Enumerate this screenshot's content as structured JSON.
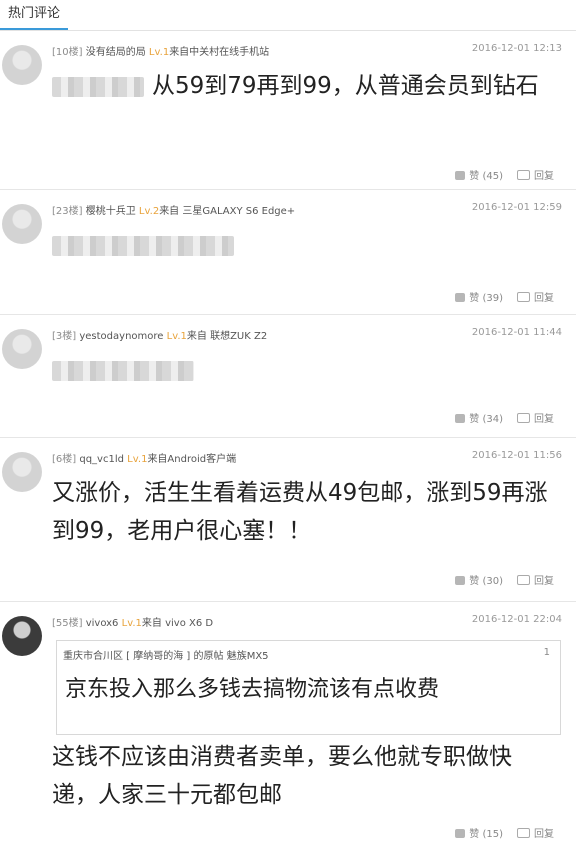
{
  "tab": {
    "label": "热门评论"
  },
  "ui": {
    "lv_prefix": "Lv."
  },
  "comments": [
    {
      "floor": "[10楼]",
      "user": "没有结局的局",
      "level": "1",
      "source": "来自中关村在线手机站",
      "time": "2016-12-01 12:13",
      "text": "从59到79再到99，从普通会员到钻石",
      "likes": "赞 (45)",
      "reply": "回复"
    },
    {
      "floor": "[23楼]",
      "user": "樱桃十兵卫",
      "level": "2",
      "source": "来自 三星GALAXY S6 Edge+",
      "time": "2016-12-01 12:59",
      "text": "",
      "likes": "赞 (39)",
      "reply": "回复"
    },
    {
      "floor": "[3楼]",
      "user": "yestodaynomore",
      "level": "1",
      "source": "来自 联想ZUK Z2",
      "time": "2016-12-01 11:44",
      "text": "",
      "likes": "赞 (34)",
      "reply": "回复"
    },
    {
      "floor": "[6楼]",
      "user": "qq_vc1ld",
      "level": "1",
      "source": "来自Android客户端",
      "time": "2016-12-01 11:56",
      "text": "又涨价，活生生看着运费从49包邮，涨到59再涨到99，老用户很心塞！！",
      "likes": "赞 (30)",
      "reply": "回复"
    },
    {
      "floor": "[55楼]",
      "user": "vivox6",
      "level": "1",
      "source": "来自 vivo X6 D",
      "time": "2016-12-01 22:04",
      "quote": {
        "meta": "重庆市合川区 [ 摩纳哥的海 ] 的原帖    魅族MX5",
        "number": "1",
        "text": "京东投入那么多钱去搞物流该有点收费"
      },
      "text": "这钱不应该由消费者卖单，要么他就专职做快递，人家三十元都包邮",
      "likes": "赞 (15)",
      "reply": "回复"
    }
  ]
}
